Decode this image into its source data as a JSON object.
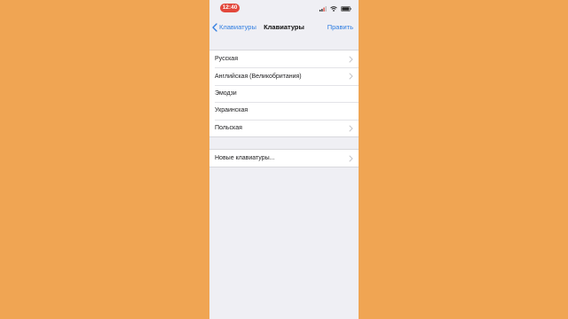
{
  "status_bar": {
    "time": "12:40",
    "time_pill_color": "#e2473b",
    "icons": [
      "signal-icon",
      "wifi-icon",
      "battery-icon"
    ]
  },
  "nav": {
    "back_label": "Клавиатуры",
    "title": "Клавиатуры",
    "edit_label": "Править",
    "accent_color": "#2f7de1"
  },
  "keyboards": [
    {
      "label": "Русская",
      "chevron": true
    },
    {
      "label": "Английская (Великобритания)",
      "chevron": true
    },
    {
      "label": "Эмодзи",
      "chevron": false
    },
    {
      "label": "Украинская",
      "chevron": false
    },
    {
      "label": "Польская",
      "chevron": true
    }
  ],
  "add_keyboard": {
    "label": "Новые клавиатуры...",
    "chevron": true
  },
  "background_color": "#f0a553"
}
